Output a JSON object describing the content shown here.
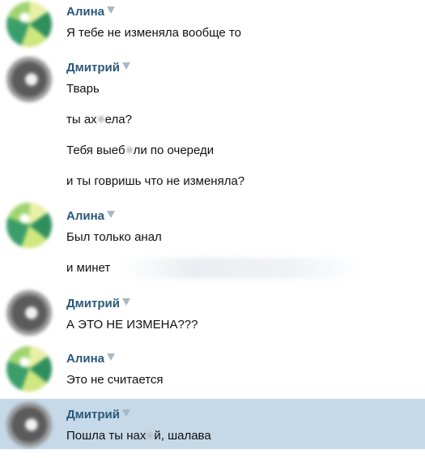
{
  "messages": [
    {
      "author": "Алина",
      "avatar_icon": "alina-avatar",
      "lines": [
        "Я тебе не изменяла вообще то"
      ]
    },
    {
      "author": "Дмитрий",
      "avatar_icon": "dmitry-avatar",
      "lines": [
        "Тварь",
        "ты ах",
        "ела?",
        "Тебя выеб",
        "ли по очереди",
        "и ты говришь что не изменяла?"
      ]
    },
    {
      "author": "Алина",
      "avatar_icon": "alina-avatar",
      "lines": [
        "Был только анал",
        "и минет"
      ]
    },
    {
      "author": "Дмитрий",
      "avatar_icon": "dmitry-avatar",
      "lines": [
        "А ЭТО НЕ ИЗМЕНА???"
      ]
    },
    {
      "author": "Алина",
      "avatar_icon": "alina-avatar",
      "lines": [
        "Это не считается"
      ]
    },
    {
      "author": "Дмитрий",
      "avatar_icon": "dmitry-avatar",
      "lines": [
        "Пошла ты нах",
        "й, шалава"
      ]
    }
  ],
  "colors": {
    "name": "#2b587a",
    "text": "#111111",
    "highlight": "#c5d9e8"
  }
}
